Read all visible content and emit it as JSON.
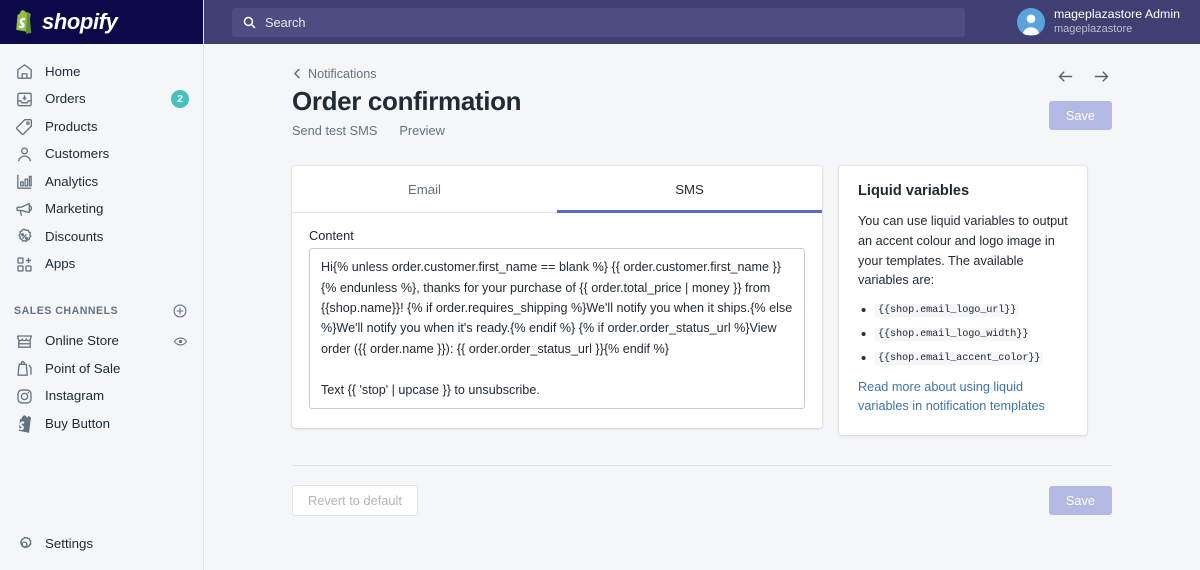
{
  "brand": {
    "name": "shopify",
    "logo_icon": "shopify-bag-icon"
  },
  "topbar": {
    "search": {
      "placeholder": "Search",
      "value": "",
      "icon": "search-icon"
    },
    "user": {
      "name": "mageplazastore Admin",
      "store": "mageplazastore",
      "avatar_icon": "user-avatar-icon"
    }
  },
  "sidebar": {
    "items": [
      {
        "label": "Home",
        "icon": "home-icon",
        "badge": ""
      },
      {
        "label": "Orders",
        "icon": "orders-inbox-icon",
        "badge": "2"
      },
      {
        "label": "Products",
        "icon": "products-tag-icon",
        "badge": ""
      },
      {
        "label": "Customers",
        "icon": "customers-person-icon",
        "badge": ""
      },
      {
        "label": "Analytics",
        "icon": "analytics-bars-icon",
        "badge": ""
      },
      {
        "label": "Marketing",
        "icon": "marketing-megaphone-icon",
        "badge": ""
      },
      {
        "label": "Discounts",
        "icon": "discounts-percent-icon",
        "badge": ""
      },
      {
        "label": "Apps",
        "icon": "apps-grid-plus-icon",
        "badge": ""
      }
    ],
    "section": {
      "title": "SALES CHANNELS",
      "action_icon": "plus-circle-icon"
    },
    "channels": [
      {
        "label": "Online Store",
        "icon": "online-store-icon",
        "trailing_icon": "eye-icon"
      },
      {
        "label": "Point of Sale",
        "icon": "point-of-sale-icon",
        "trailing_icon": ""
      },
      {
        "label": "Instagram",
        "icon": "instagram-icon",
        "trailing_icon": ""
      },
      {
        "label": "Buy Button",
        "icon": "buy-button-icon",
        "trailing_icon": ""
      }
    ],
    "settings": {
      "label": "Settings",
      "icon": "gear-icon"
    }
  },
  "page": {
    "breadcrumb": {
      "label": "Notifications",
      "icon": "chevron-left-icon"
    },
    "title": "Order confirmation",
    "sublinks": [
      {
        "label": "Send test SMS"
      },
      {
        "label": "Preview"
      }
    ],
    "nav": {
      "prev_icon": "arrow-left-icon",
      "next_icon": "arrow-right-icon"
    },
    "save_label": "Save"
  },
  "tabs": [
    {
      "label": "Email",
      "active": false
    },
    {
      "label": "SMS",
      "active": true
    }
  ],
  "content": {
    "label": "Content",
    "value": "Hi{% unless order.customer.first_name == blank %} {{ order.customer.first_name }}{% endunless %}, thanks for your purchase of {{ order.total_price | money }} from {{shop.name}}! {% if order.requires_shipping %}We'll notify you when it ships.{% else %}We'll notify you when it's ready.{% endif %} {% if order.order_status_url %}View order ({{ order.name }}): {{ order.order_status_url }}{% endif %}\n\nText {{ 'stop' | upcase }} to unsubscribe."
  },
  "liquid_card": {
    "title": "Liquid variables",
    "description": "You can use liquid variables to output an accent colour and logo image in your templates. The available variables are:",
    "variables": [
      "{{shop.email_logo_url}}",
      "{{shop.email_logo_width}}",
      "{{shop.email_accent_color}}"
    ],
    "link": "Read more about using liquid variables in notification templates"
  },
  "footer": {
    "revert_label": "Revert to default",
    "save_label": "Save"
  },
  "colors": {
    "brand_navy": "#0a0a48",
    "topbar_indigo": "#3f3f72",
    "accent_indigo": "#5c6ac4",
    "badge_teal": "#47c1bf",
    "page_bg": "#f4f6f8",
    "save_disabled": "#b3b9e2",
    "link_blue": "#3f76a8"
  }
}
